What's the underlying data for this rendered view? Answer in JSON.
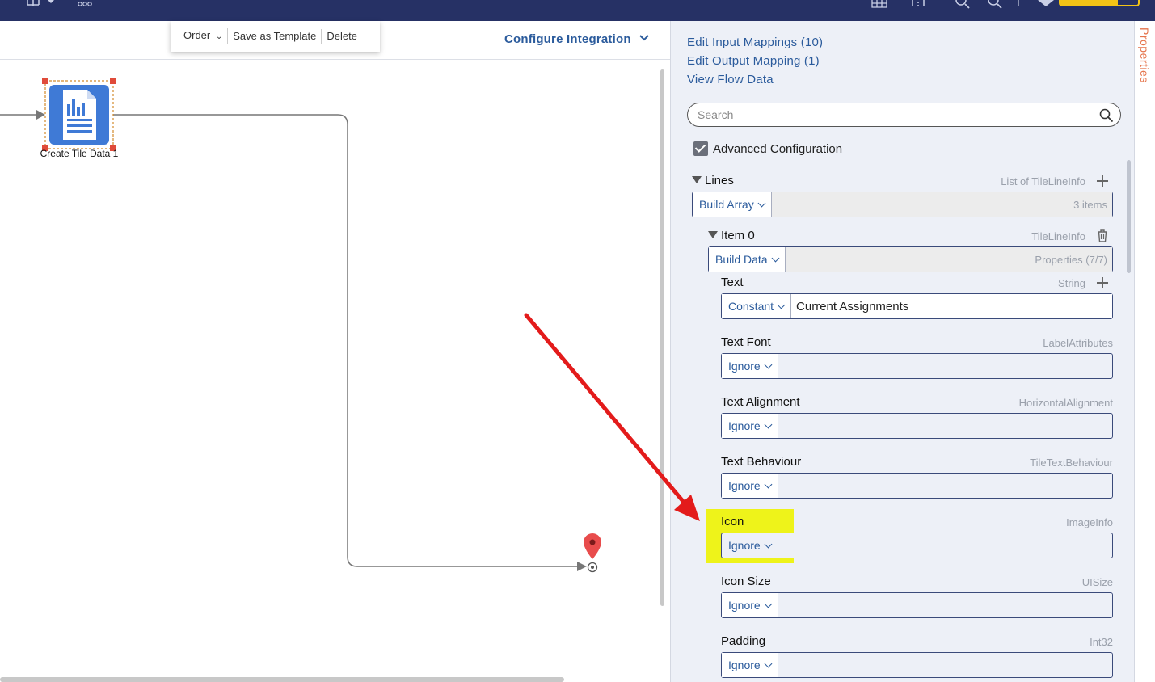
{
  "colors": {
    "topbar": "#263165",
    "accent_link": "#2b5b9c",
    "panel_bg": "#edf0f7",
    "highlight": "#eef31a",
    "arrow": "#e31b1b",
    "properties_tab": "#e5734a",
    "node_icon": "#3f7ad6",
    "end_marker": "#e84c4c"
  },
  "topbar": {
    "icons": [
      "sitemap-icon",
      "dropdown-caret-icon",
      "org-chart-icon",
      "grid-icon",
      "one-to-one-icon",
      "zoom-out-icon",
      "zoom-in-icon",
      "heart-icon"
    ],
    "progress_fraction": 0.74
  },
  "toolbar": {
    "order_label": "Order",
    "save_template_label": "Save as Template",
    "delete_label": "Delete"
  },
  "canvas": {
    "configure_label": "Configure Integration",
    "node": {
      "label": "Create Tile Data 1",
      "icon": "report-document-icon"
    }
  },
  "panel": {
    "tab_label": "Properties",
    "links": {
      "input_mappings": "Edit Input Mappings (10)",
      "output_mapping": "Edit Output Mapping (1)",
      "view_flow_data": "View Flow Data"
    },
    "search_placeholder": "Search",
    "advanced_label": "Advanced Configuration",
    "advanced_checked": true,
    "lines": {
      "label": "Lines",
      "type": "List of TileLineInfo",
      "mode": "Build Array",
      "value": "3 items"
    },
    "item0": {
      "label": "Item 0",
      "type": "TileLineInfo",
      "mode": "Build Data",
      "value": "Properties (7/7)"
    },
    "props": [
      {
        "label": "Text",
        "type": "String",
        "mode": "Constant",
        "value": "Current Assignments"
      },
      {
        "label": "Text Font",
        "type": "LabelAttributes",
        "mode": "Ignore",
        "value": ""
      },
      {
        "label": "Text Alignment",
        "type": "HorizontalAlignment",
        "mode": "Ignore",
        "value": ""
      },
      {
        "label": "Text Behaviour",
        "type": "TileTextBehaviour",
        "mode": "Ignore",
        "value": ""
      },
      {
        "label": "Icon",
        "type": "ImageInfo",
        "mode": "Ignore",
        "value": ""
      },
      {
        "label": "Icon Size",
        "type": "UISize",
        "mode": "Ignore",
        "value": ""
      },
      {
        "label": "Padding",
        "type": "Int32",
        "mode": "Ignore",
        "value": ""
      }
    ]
  }
}
